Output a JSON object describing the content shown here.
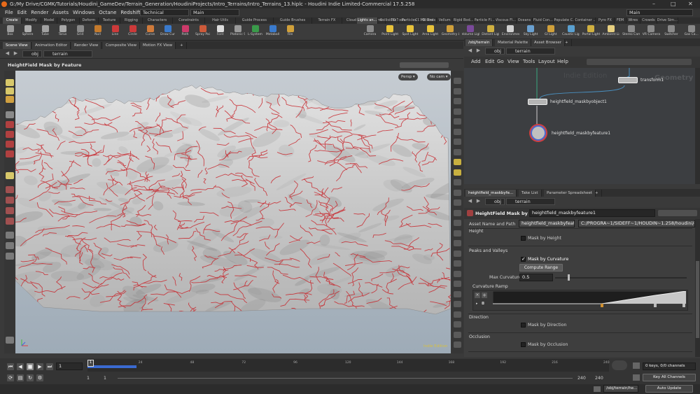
{
  "window": {
    "title": "G:/My Drive/CGMK/Tutorials/Houdini_GameDev/Terrain_Generation/HoudiniProjects/Intro_Terrains/Intro_Terrains_13.hiplc - Houdini Indie Limited-Commercial 17.5.258",
    "minimize": "–",
    "maximize": "□",
    "close": "✕"
  },
  "menubar": {
    "items": [
      "File",
      "Edit",
      "Render",
      "Assets",
      "Windows",
      "Octane",
      "Redshift",
      "Help"
    ],
    "desktop": "Technical",
    "session": "Main",
    "right_desktop": "Main"
  },
  "shelf_tabs_left": [
    "Create",
    "Modify",
    "Model",
    "Polygon",
    "Deform",
    "Texture",
    "Rigging",
    "Characters",
    "Constraints",
    "Hair Utils",
    "Guide Process",
    "Guide Brushes",
    "Terrain FX",
    "Cloud FX",
    "Volume",
    "TD Tools",
    "CGMK Tools"
  ],
  "shelf_tabs_right": [
    "Lights an...",
    "Collisions",
    "Particles",
    "Grains",
    "Vellum",
    "Rigid Bod...",
    "Particle Fl...",
    "Viscous Fl...",
    "Oceans",
    "Fluid Con...",
    "Populate C...",
    "Container ...",
    "Pyro FX",
    "FEM",
    "Wires",
    "Crowds",
    "Drive Sim..."
  ],
  "shelf_tools_left": [
    {
      "label": "Box",
      "color": "#9a9a9a"
    },
    {
      "label": "Sphere",
      "color": "#b0b0b0"
    },
    {
      "label": "Tube",
      "color": "#a0a0a0"
    },
    {
      "label": "Torus",
      "color": "#a8a8a8"
    },
    {
      "label": "Grid",
      "color": "#8a8a8a"
    },
    {
      "label": "Null",
      "color": "#c47a2c"
    },
    {
      "label": "Line",
      "color": "#cc3a3a"
    },
    {
      "label": "Circle",
      "color": "#cc3a3a"
    },
    {
      "label": "Curve",
      "color": "#d07a3a"
    },
    {
      "label": "Draw Curve",
      "color": "#3a7acc"
    },
    {
      "label": "Path",
      "color": "#cc3a6a"
    },
    {
      "label": "Spray Paint",
      "color": "#cc5a3a"
    },
    {
      "label": "Font",
      "color": "#dddddd"
    },
    {
      "label": "Platonic Solids",
      "color": "#9a9a9a"
    },
    {
      "label": "L-System",
      "color": "#3a9a4a"
    },
    {
      "label": "Metaball",
      "color": "#3a7acc"
    },
    {
      "label": "File",
      "color": "#d0a03a"
    }
  ],
  "shelf_tools_right": [
    {
      "label": "Camera",
      "color": "#8a8a8a"
    },
    {
      "label": "Point Light",
      "color": "#e8c23a"
    },
    {
      "label": "Spot Light",
      "color": "#e8c23a"
    },
    {
      "label": "Area Light",
      "color": "#e8c23a"
    },
    {
      "label": "Geometry Light",
      "color": "#d0a03a"
    },
    {
      "label": "Volume Light",
      "color": "#7a4a9a"
    },
    {
      "label": "Distant Light",
      "color": "#d0b040"
    },
    {
      "label": "Environment Light",
      "color": "#d0d0d0"
    },
    {
      "label": "Sky Light",
      "color": "#6aa0d0"
    },
    {
      "label": "GI Light",
      "color": "#d0a03a"
    },
    {
      "label": "Caustic Light",
      "color": "#5aa0d0"
    },
    {
      "label": "Portal Light",
      "color": "#d0b040"
    },
    {
      "label": "Ambient Light",
      "color": "#e8d080"
    },
    {
      "label": "Stereo Camera",
      "color": "#8a8a8a"
    },
    {
      "label": "VR Camera",
      "color": "#8a8a8a"
    },
    {
      "label": "Switcher",
      "color": "#8a8a8a"
    },
    {
      "label": "Gas Ca...",
      "color": "#8a8a8a"
    }
  ],
  "left_pane": {
    "tabs": [
      "Scene View",
      "Animation Editor",
      "Render View",
      "Composite View",
      "Motion FX View"
    ],
    "path": [
      "obj",
      "terrain"
    ],
    "viewport_title": "HeightField Mask by Feature",
    "persp": "Persp ▾",
    "cam": "No cam ▾",
    "watermark": "Indie Edition"
  },
  "network": {
    "tabs": [
      "/obj/terrain",
      "Material Palette",
      "Asset Browser"
    ],
    "path": [
      "obj",
      "terrain"
    ],
    "menu": [
      "Add",
      "Edit",
      "Go",
      "View",
      "Tools",
      "Layout",
      "Help"
    ],
    "watermark_indie": "Indie Edition",
    "watermark_context": "Geometry",
    "nodes": {
      "transform": "transform1",
      "maskbyobject": "heightfield_maskbyobject1",
      "maskbyfeature": "heightfield_maskbyfeature1"
    }
  },
  "params": {
    "tabs": [
      "heightfield_maskbyfe...",
      "Take List",
      "Parameter Spreadsheet"
    ],
    "path": [
      "obj",
      "terrain"
    ],
    "node_type": "HeightField Mask by Feature",
    "node_name": "heightfield_maskbyfeature1",
    "asset_label": "Asset Name and Path",
    "asset_name": "heightfield_maskbyfeat...",
    "asset_path": "C:/PROGRA~1/SIDEFF~1/HOUDIN~1.258/houdini/otls/O...",
    "height_section": "Height",
    "mask_by_height": "Mask by Height",
    "peaks_section": "Peaks and Valleys",
    "mask_by_curvature": "Mask by Curvature",
    "mask_by_curvature_checked": true,
    "compute_range": "Compute Range",
    "max_curvature_label": "Max Curvature",
    "max_curvature": "0.5",
    "curvature_ramp": "Curvature Ramp",
    "direction_section": "Direction",
    "mask_by_direction": "Mask by Direction",
    "occlusion_section": "Occlusion",
    "mask_by_occlusion": "Mask by Occlusion"
  },
  "timeline": {
    "ticks": [
      "1",
      "24",
      "48",
      "72",
      "96",
      "120",
      "144",
      "168",
      "192",
      "216",
      "240"
    ],
    "frame": "1",
    "start": "1",
    "start2": "1",
    "end": "240",
    "end2": "240",
    "keys": "0 keys, 0/0 channels",
    "key_all": "Key All Channels",
    "status_path": "/obj/terrain/he...",
    "auto_update": "Auto Update"
  }
}
